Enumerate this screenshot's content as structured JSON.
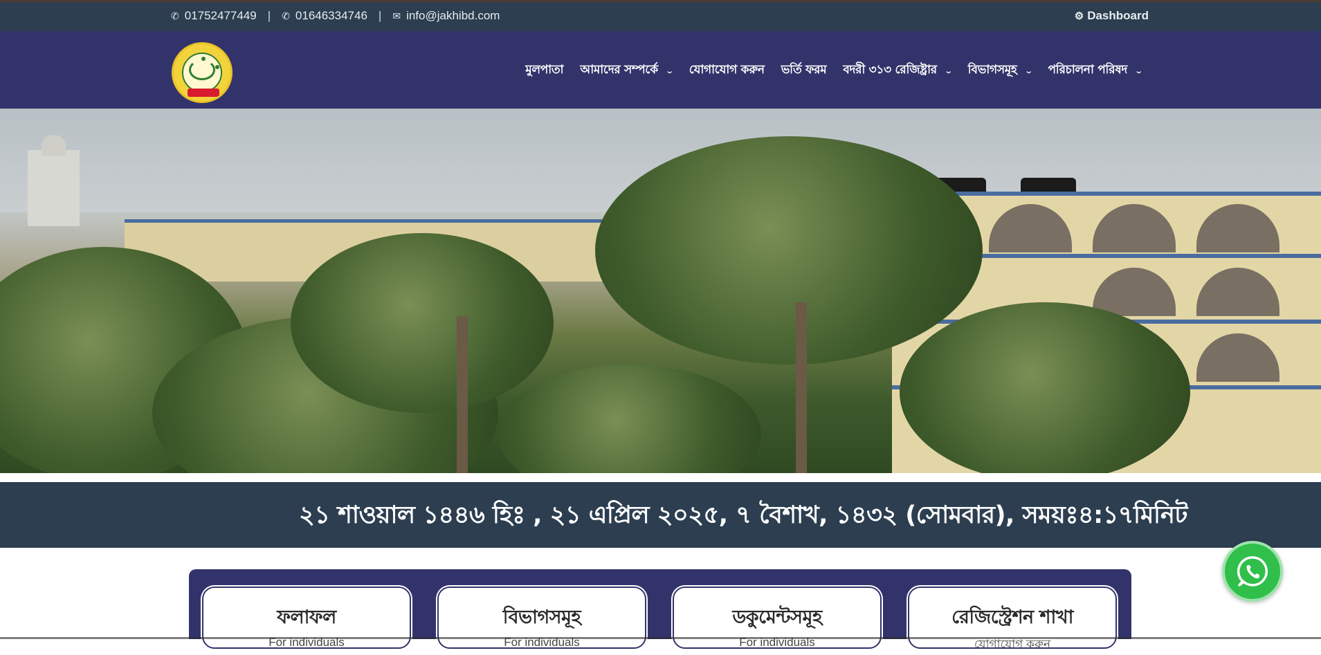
{
  "topbar": {
    "phone1": "01752477449",
    "phone2": "01646334746",
    "email": "info@jakhibd.com",
    "separator": "|",
    "dashboard_label": "Dashboard",
    "icons": [
      "phone-icon",
      "phone-icon",
      "envelope-icon",
      "gear-icon"
    ]
  },
  "nav": {
    "items": [
      {
        "label": "মুলপাতা",
        "dropdown": false
      },
      {
        "label": "আমাদের সম্পর্কে",
        "dropdown": true
      },
      {
        "label": "যোগাযোগ করুন",
        "dropdown": false
      },
      {
        "label": "ভর্তি ফরম",
        "dropdown": false
      },
      {
        "label": "বদরী ৩১৩ রেজিষ্ট্রার",
        "dropdown": true
      },
      {
        "label": "বিভাগসমূহ",
        "dropdown": true
      },
      {
        "label": "পরিচালনা পরিষদ",
        "dropdown": true
      }
    ]
  },
  "datebar": {
    "text": "২১ শাওয়াল ১৪৪৬ হিঃ , ২১ এপ্রিল ২০২৫, ৭ বৈশাখ, ১৪৩২ (সোমবার), সময়ঃ৪:১৭মিনিট"
  },
  "cards": [
    {
      "title": "ফলাফল",
      "subtitle": "For individuals"
    },
    {
      "title": "বিভাগসমূহ",
      "subtitle": "For individuals"
    },
    {
      "title": "ডকুমেন্টসমূহ",
      "subtitle": "For individuals"
    },
    {
      "title": "রেজিস্ট্রেশন শাখা",
      "subtitle": "যোগাযোগ করুন"
    }
  ],
  "colors": {
    "topbar_bg": "#2c3e50",
    "navbar_bg": "#33336b",
    "whatsapp_green": "#2fbf4a"
  }
}
